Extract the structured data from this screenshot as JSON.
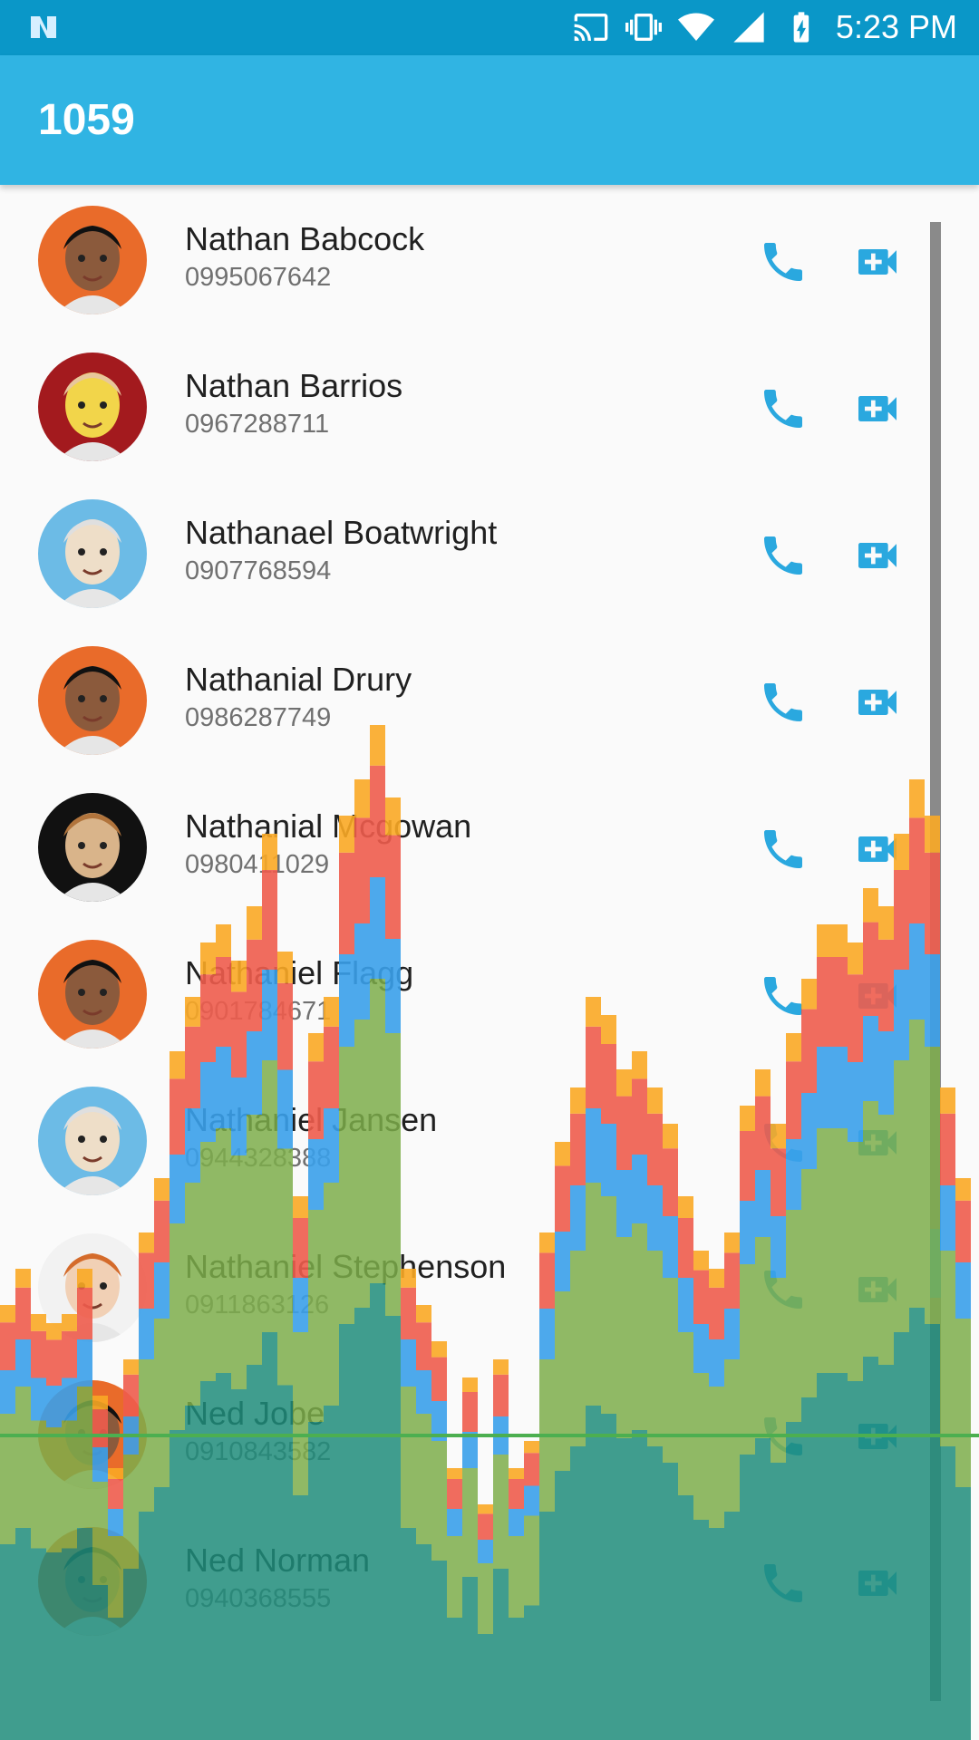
{
  "status_bar": {
    "time": "5:23 PM",
    "icons": [
      "notification-n-icon",
      "cast-icon",
      "vibrate-icon",
      "wifi-icon",
      "cell-signal-icon",
      "battery-charging-icon"
    ]
  },
  "app_bar": {
    "title": "1059"
  },
  "contacts": [
    {
      "name": "Nathan Babcock",
      "phone": "0995067642",
      "avatar_colors": [
        "#e96b2a",
        "#8b5a3c",
        "#111"
      ]
    },
    {
      "name": "Nathan Barrios",
      "phone": "0967288711",
      "avatar_colors": [
        "#a31a1e",
        "#f2d54a",
        "#e8c79b"
      ]
    },
    {
      "name": "Nathanael Boatwright",
      "phone": "0907768594",
      "avatar_colors": [
        "#6cbbe6",
        "#eedec8",
        "#dfdfdf"
      ]
    },
    {
      "name": "Nathanial Drury",
      "phone": "0986287749",
      "avatar_colors": [
        "#e96b2a",
        "#8b5a3c",
        "#111"
      ]
    },
    {
      "name": "Nathanial Mcgowan",
      "phone": "0980411029",
      "avatar_colors": [
        "#111111",
        "#d9b48a",
        "#b1743c"
      ]
    },
    {
      "name": "Nathaniel Flagg",
      "phone": "0901784671",
      "avatar_colors": [
        "#e96b2a",
        "#8b5a3c",
        "#111"
      ]
    },
    {
      "name": "Nathaniel Jansen",
      "phone": "0944328388",
      "avatar_colors": [
        "#6cbbe6",
        "#eedec8",
        "#dfdfdf"
      ]
    },
    {
      "name": "Nathaniel Stephenson",
      "phone": "0911863126",
      "avatar_colors": [
        "#f2f2f2",
        "#f1d0b5",
        "#d46b2b"
      ]
    },
    {
      "name": "Ned Jobe",
      "phone": "0910843582",
      "avatar_colors": [
        "#e96b2a",
        "#8b5a3c",
        "#111"
      ]
    },
    {
      "name": "Ned Norman",
      "phone": "0940368555",
      "avatar_colors": [
        "#e96b2a",
        "#8b5a3c",
        "#111"
      ]
    }
  ],
  "accent_color": "#30b4e3",
  "icon_color": "#2aa8df",
  "overlay": {
    "description": "GPU rendering profile bars",
    "colors": {
      "teal": "#1e8c7a",
      "green": "#7cad4a",
      "blue": "#3aa0ea",
      "red": "#ee5c4c",
      "orange": "#f9a825"
    }
  }
}
